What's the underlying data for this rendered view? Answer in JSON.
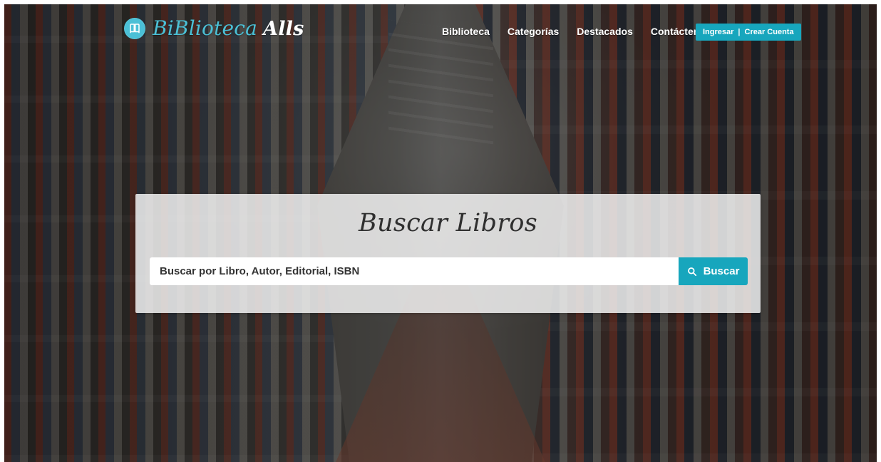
{
  "brand": {
    "name": "BiBlioteca",
    "suffix": "Alls",
    "icon": "book-icon",
    "accent_color": "#4bc0d6"
  },
  "nav": {
    "items": [
      {
        "label": "Biblioteca"
      },
      {
        "label": "Categorías"
      },
      {
        "label": "Destacados"
      },
      {
        "label": "Contáctenos"
      }
    ]
  },
  "auth": {
    "login": "Ingresar",
    "separator": "|",
    "register": "Crear Cuenta",
    "color": "#17a6bd"
  },
  "search": {
    "title": "Buscar Libros",
    "placeholder": "Buscar por Libro, Autor, Editorial, ISBN",
    "button_label": "Buscar",
    "icon": "search-icon",
    "button_color": "#17a6bd"
  }
}
